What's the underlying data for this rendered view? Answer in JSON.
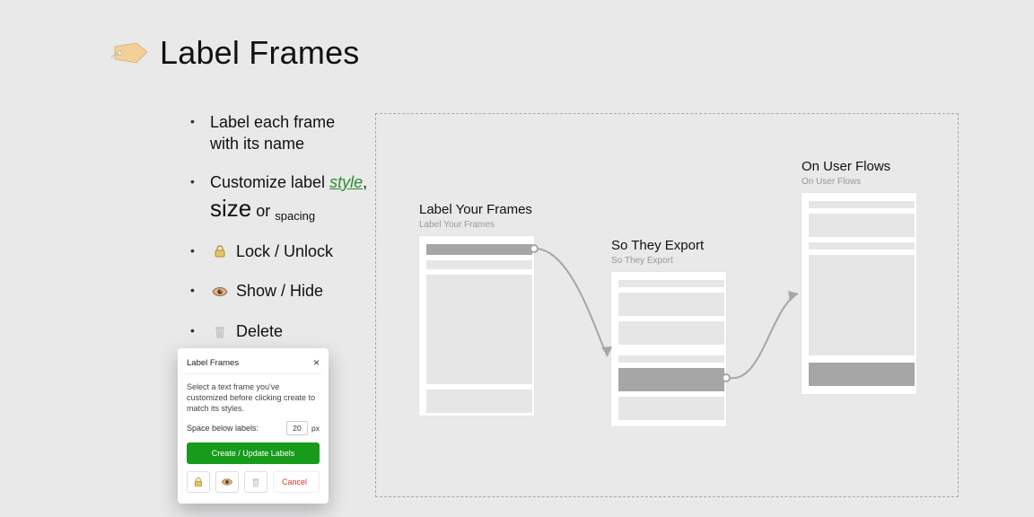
{
  "title": "Label Frames",
  "bullets": {
    "b1a": "Label each frame",
    "b1b": "with its name",
    "b2a": "Customize label ",
    "style_word": "style",
    "b2b": ",",
    "size_word": "size",
    "b2c": " or ",
    "spacing_word": "spacing",
    "b3": "Lock / Unlock",
    "b4": "Show / Hide",
    "b5": "Delete"
  },
  "dialog": {
    "title": "Label Frames",
    "desc": "Select a text frame you've customized before clicking create to match its styles.",
    "space_label": "Space below labels:",
    "space_value": "20",
    "space_unit": "px",
    "primary": "Create / Update Labels",
    "cancel": "Cancel"
  },
  "canvas": {
    "f1": {
      "title": "Label Your Frames",
      "sub": "Label Your Frames"
    },
    "f2": {
      "title": "So They Export",
      "sub": "So They Export"
    },
    "f3": {
      "title": "On User Flows",
      "sub": "On User Flows"
    }
  }
}
